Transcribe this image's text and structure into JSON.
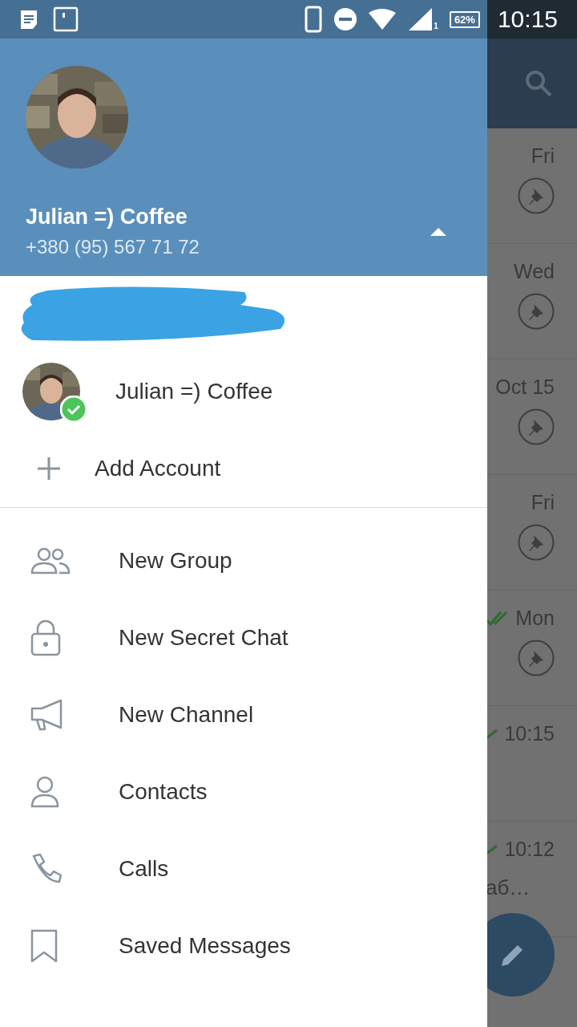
{
  "status_bar": {
    "signal_sim": "1",
    "battery": "62%",
    "time": "10:15"
  },
  "drawer": {
    "profile": {
      "name": "Julian =) Coffee",
      "phone": "+380 (95) 567 71 72",
      "accounts_expanded": true
    },
    "accounts": [
      {
        "kind": "redacted"
      },
      {
        "kind": "account",
        "name": "Julian =) Coffee",
        "selected": true
      },
      {
        "kind": "add",
        "label": "Add Account"
      }
    ],
    "menu": [
      {
        "label": "New Group"
      },
      {
        "label": "New Secret Chat"
      },
      {
        "label": "New Channel"
      },
      {
        "label": "Contacts"
      },
      {
        "label": "Calls"
      },
      {
        "label": "Saved Messages"
      }
    ]
  },
  "chat_list": [
    {
      "time": "Fri",
      "pinned": true,
      "kind": "plain"
    },
    {
      "time": "Wed",
      "pinned": true,
      "kind": "plain"
    },
    {
      "time": "Oct 15",
      "pinned": true,
      "kind": "plain"
    },
    {
      "time": "Fri",
      "pinned": true,
      "kind": "plain"
    },
    {
      "time": "Mon",
      "pinned": true,
      "kind": "read"
    },
    {
      "time": "10:15",
      "pinned": false,
      "kind": "sent"
    },
    {
      "time": "10:12",
      "pinned": false,
      "kind": "sent",
      "preview": "аб…"
    }
  ]
}
